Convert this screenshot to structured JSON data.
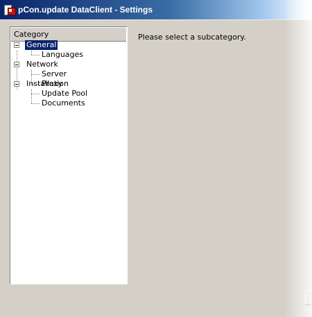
{
  "window": {
    "title": "pCon.update DataClient - Settings"
  },
  "category_panel": {
    "header": "Category",
    "tree": [
      {
        "label": "General",
        "selected": true,
        "children": [
          "Languages"
        ]
      },
      {
        "label": "Network",
        "selected": false,
        "children": [
          "Server",
          "Proxy"
        ]
      },
      {
        "label": "Installation",
        "selected": false,
        "children": [
          "Update Pool",
          "Documents"
        ]
      }
    ]
  },
  "main": {
    "message": "Please select a subcategory."
  },
  "colors": {
    "titlebar_start": "#0a246a",
    "selection": "#0a246a",
    "face": "#d4d0c8"
  }
}
